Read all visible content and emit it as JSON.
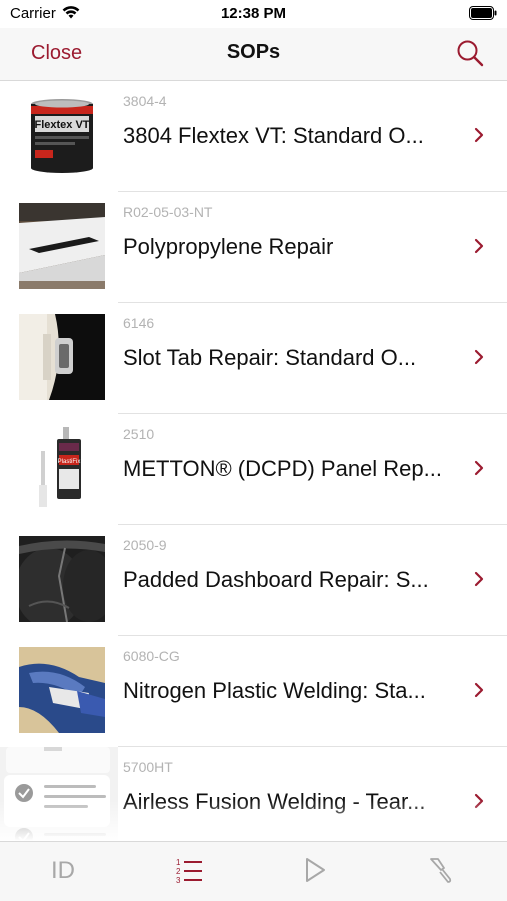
{
  "status": {
    "carrier": "Carrier",
    "time": "12:38 PM"
  },
  "nav": {
    "close_label": "Close",
    "title": "SOPs",
    "search_icon": "search-icon"
  },
  "colors": {
    "accent": "#9b1b30",
    "inactive_icon": "#a8a8a8",
    "code_text": "#b3b3b3"
  },
  "items": [
    {
      "code": "3804-4",
      "title": "3804 Flextex VT: Standard O...",
      "thumb": "product-can"
    },
    {
      "code": "R02-05-03-NT",
      "title": "Polypropylene Repair",
      "thumb": "repair-photo"
    },
    {
      "code": "6146",
      "title": "Slot Tab Repair:  Standard O...",
      "thumb": "repair-photo"
    },
    {
      "code": "2510",
      "title": "METTON® (DCPD) Panel Rep...",
      "thumb": "adhesive-cartridge"
    },
    {
      "code": "2050-9",
      "title": "Padded Dashboard Repair: S...",
      "thumb": "repair-photo"
    },
    {
      "code": "6080-CG",
      "title": "Nitrogen Plastic Welding: Sta...",
      "thumb": "repair-photo"
    },
    {
      "code": "5700HT",
      "title": "Airless Fusion Welding - Tear...",
      "thumb": "checklist-graphic"
    }
  ],
  "product_labels": {
    "can_label": "Flextex VT",
    "cartridge_label": "PlastiFix"
  },
  "tabs": [
    {
      "label": "ID",
      "icon": "id-tab-icon",
      "active": false
    },
    {
      "label": "",
      "icon": "numbered-list-icon",
      "active": true
    },
    {
      "label": "",
      "icon": "play-icon",
      "active": false
    },
    {
      "label": "",
      "icon": "welding-tool-icon",
      "active": false
    }
  ]
}
